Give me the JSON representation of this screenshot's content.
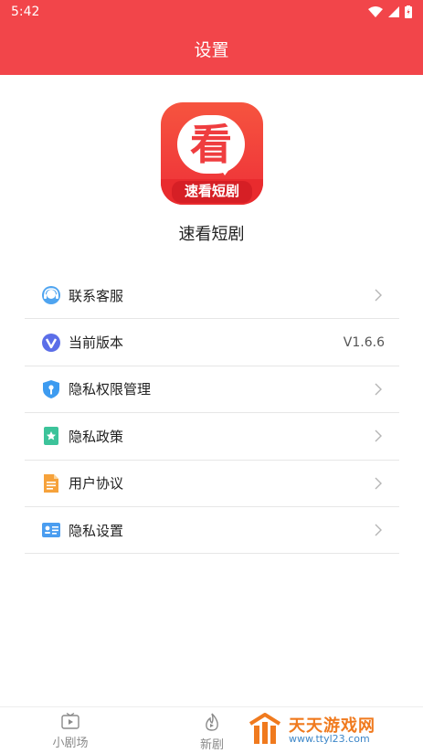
{
  "status_bar": {
    "time": "5:42"
  },
  "header": {
    "title": "设置"
  },
  "app": {
    "logo_char": "看",
    "logo_band_text": "速看短剧",
    "name": "速看短剧"
  },
  "menu": {
    "items": [
      {
        "label": "联系客服",
        "icon": "headset-icon"
      },
      {
        "label": "当前版本",
        "value": "V1.6.6",
        "icon": "version-icon"
      },
      {
        "label": "隐私权限管理",
        "icon": "shield-icon"
      },
      {
        "label": "隐私政策",
        "icon": "bookmark-star-icon"
      },
      {
        "label": "用户协议",
        "icon": "document-icon"
      },
      {
        "label": "隐私设置",
        "icon": "id-card-icon"
      }
    ]
  },
  "tabbar": {
    "tabs": [
      {
        "label": "小剧场",
        "icon": "tv-icon"
      },
      {
        "label": "新剧",
        "icon": "flame-icon"
      }
    ]
  },
  "watermark": {
    "title": "天天游戏网",
    "url": "www.ttyl23.com"
  },
  "colors": {
    "accent": "#f2454a",
    "divider": "#e6e6e6",
    "tab_text": "#8a8a8a"
  }
}
